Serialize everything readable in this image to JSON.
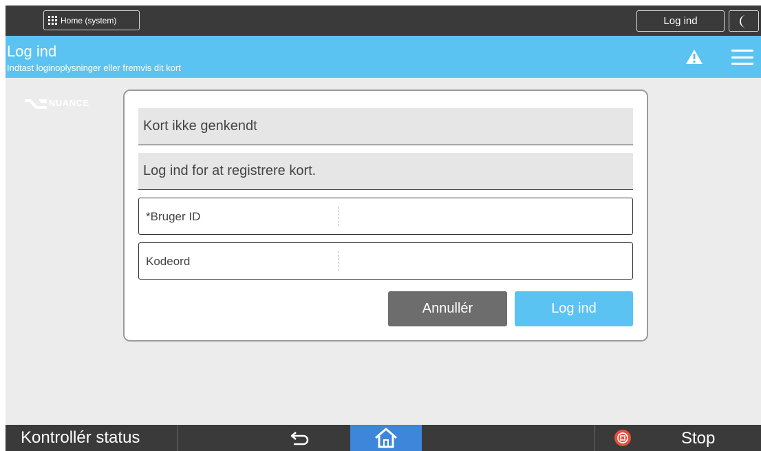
{
  "system_bar": {
    "home_label": "Home (system)",
    "login_label": "Log ind",
    "sleep_icon": "moon-icon"
  },
  "header": {
    "title": "Log ind",
    "subtitle": "Indtast loginoplysninger eller fremvis dit kort",
    "icons": [
      "warning-icon",
      "menu-icon"
    ]
  },
  "logo": {
    "text": "NUANCE"
  },
  "dialog": {
    "message1": "Kort ikke genkendt",
    "message2": "Log ind for at registrere kort.",
    "user_id_label": "*Bruger ID",
    "user_id_value": "",
    "password_label": "Kodeord",
    "password_value": "",
    "cancel_label": "Annullér",
    "login_label": "Log ind"
  },
  "bottom_bar": {
    "status_label": "Kontrollér status",
    "stop_label": "Stop",
    "icons": [
      "back-icon",
      "home-icon",
      "stop-icon"
    ]
  },
  "colors": {
    "accent": "#5ac3f2",
    "dark_bar": "#3a3a3a",
    "home_active": "#3d86d9",
    "cancel": "#6d6d6d",
    "stop": "#e8503a"
  }
}
